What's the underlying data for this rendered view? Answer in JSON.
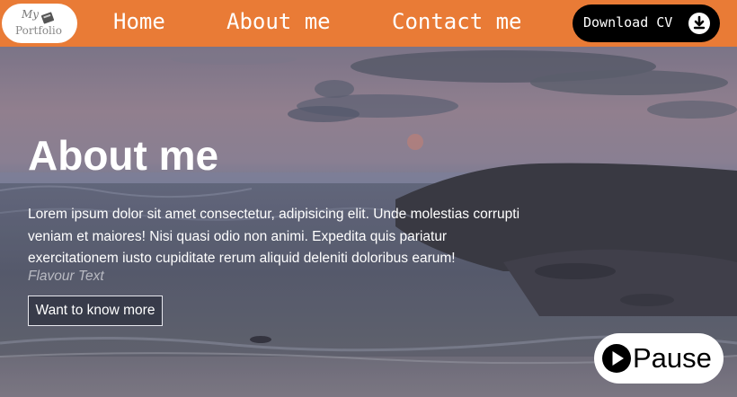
{
  "logo": {
    "line1": "My",
    "line2": "Portfolio"
  },
  "nav": {
    "items": [
      {
        "label": "Home"
      },
      {
        "label": "About me"
      },
      {
        "label": "Contact me"
      }
    ],
    "download_label": "Download CV",
    "download_icon": "download-circle-icon",
    "accent": "#e97b36"
  },
  "hero": {
    "title": "About me",
    "description": "Lorem ipsum dolor sit amet consectetur, adipisicing elit. Unde molestias corrupti veniam et maiores! Nisi quasi odio non animi. Expedita quis pariatur exercitationem iusto cupiditate rerum aliquid deleniti doloribus earum!",
    "flavour": "Flavour Text",
    "cta_label": "Want to know more",
    "video_control": {
      "label": "Pause",
      "icon": "play-icon"
    }
  }
}
